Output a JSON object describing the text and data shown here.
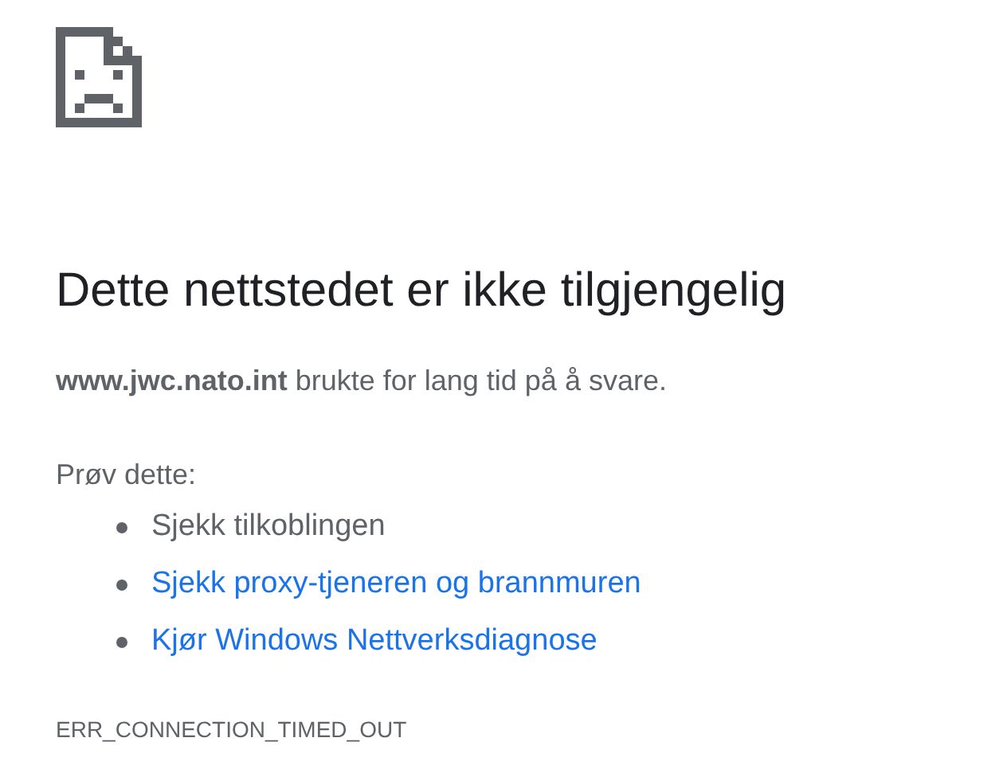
{
  "heading": "Dette nettstedet er ikke tilgjengelig",
  "message": "**www.jwc.nato.int** brukte for lang tid på å svare.",
  "suggestions_title": "Prøv dette:",
  "suggestions": [
    {
      "kind": "text",
      "label": "Sjekk tilkoblingen"
    },
    {
      "kind": "link",
      "label": "Sjekk proxy-tjeneren og brannmuren"
    },
    {
      "kind": "link",
      "label": "Kjør Windows Nettverksdiagnose"
    }
  ],
  "error_code": "ERR_CONNECTION_TIMED_OUT"
}
